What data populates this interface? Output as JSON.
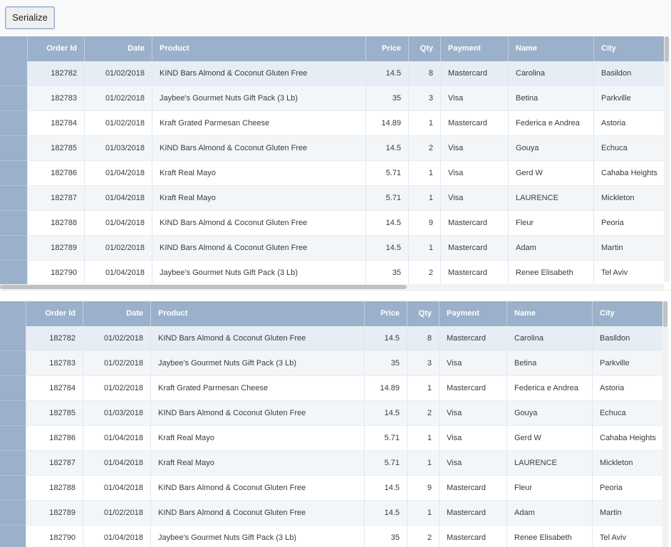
{
  "toolbar": {
    "serialize_label": "Serialize"
  },
  "columns": [
    "Order Id",
    "Date",
    "Product",
    "Price",
    "Qty",
    "Payment",
    "Name",
    "City"
  ],
  "rows": [
    [
      "182782",
      "01/02/2018",
      "KIND Bars Almond & Coconut Gluten Free",
      "14.5",
      "8",
      "Mastercard",
      "Carolina",
      "Basildon"
    ],
    [
      "182783",
      "01/02/2018",
      "Jaybee's Gourmet Nuts Gift Pack (3 Lb)",
      "35",
      "3",
      "Visa",
      "Betina",
      "Parkville"
    ],
    [
      "182784",
      "01/02/2018",
      "Kraft Grated Parmesan Cheese",
      "14.89",
      "1",
      "Mastercard",
      "Federica e Andrea",
      "Astoria"
    ],
    [
      "182785",
      "01/03/2018",
      "KIND Bars Almond & Coconut Gluten Free",
      "14.5",
      "2",
      "Visa",
      "Gouya",
      "Echuca"
    ],
    [
      "182786",
      "01/04/2018",
      "Kraft Real Mayo",
      "5.71",
      "1",
      "Visa",
      "Gerd W",
      "Cahaba Heights"
    ],
    [
      "182787",
      "01/04/2018",
      "Kraft Real Mayo",
      "5.71",
      "1",
      "Visa",
      "LAURENCE",
      "Mickleton"
    ],
    [
      "182788",
      "01/04/2018",
      "KIND Bars Almond & Coconut Gluten Free",
      "14.5",
      "9",
      "Mastercard",
      "Fleur",
      "Peoria"
    ],
    [
      "182789",
      "01/02/2018",
      "KIND Bars Almond & Coconut Gluten Free",
      "14.5",
      "1",
      "Mastercard",
      "Adam",
      "Martin"
    ],
    [
      "182790",
      "01/04/2018",
      "Jaybee's Gourmet Nuts Gift Pack (3 Lb)",
      "35",
      "2",
      "Mastercard",
      "Renee Elisabeth",
      "Tel Aviv"
    ]
  ],
  "colors": {
    "header_bg": "#9bb0ca",
    "selected_row": "#e6edf5",
    "alt_row": "#f3f6f9"
  }
}
